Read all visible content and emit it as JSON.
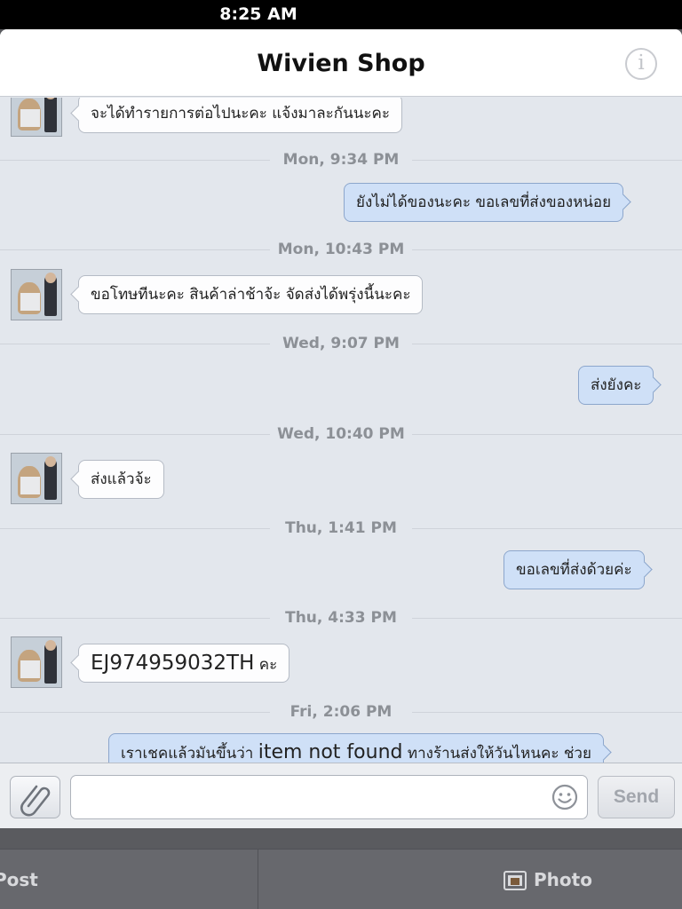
{
  "status_bar": {
    "time": "8:25 AM"
  },
  "header": {
    "title": "Wivien Shop",
    "info_icon": "info-icon"
  },
  "messages": [
    {
      "type": "in",
      "text": "จะได้ทำรายการต่อไปนะคะ แจ้งมาละกันนะคะ"
    },
    {
      "type": "time",
      "text": "Mon, 9:34 PM"
    },
    {
      "type": "out",
      "text": "ยังไม่ได้ของนะคะ ขอเลขที่ส่งของหน่อย"
    },
    {
      "type": "time",
      "text": "Mon, 10:43 PM"
    },
    {
      "type": "in",
      "text": "ขอโทษทีนะคะ สินค้าล่าช้าจ้ะ จัดส่งได้พรุ่งนี้นะคะ"
    },
    {
      "type": "time",
      "text": "Wed, 9:07 PM"
    },
    {
      "type": "out",
      "text": "ส่งยังคะ"
    },
    {
      "type": "time",
      "text": "Wed, 10:40 PM"
    },
    {
      "type": "in",
      "text": "ส่งแล้วจ้ะ"
    },
    {
      "type": "time",
      "text": "Thu, 1:41 PM"
    },
    {
      "type": "out",
      "text": "ขอเลขที่ส่งด้วยค่ะ"
    },
    {
      "type": "time",
      "text": "Thu, 4:33 PM"
    },
    {
      "type": "in",
      "text_main": "EJ974959032TH",
      "text_suffix": " คะ"
    },
    {
      "type": "time",
      "text": "Fri, 2:06 PM"
    },
    {
      "type": "out",
      "text_pre": "เราเชคแล้วมันขึ้นว่า ",
      "text_mid": "item not found",
      "text_post": " ทางร้านส่งให้วันไหนคะ ช่วย"
    }
  ],
  "composer": {
    "attach_icon": "paperclip-icon",
    "input_value": "",
    "input_placeholder": "",
    "emoji_icon": "smiley-icon",
    "send_label": "Send"
  },
  "bottom_bar": {
    "post_label": "Post",
    "photo_label": "Photo",
    "photo_icon": "photo-icon"
  },
  "colors": {
    "outgoing_bubble": "#cfe0f7",
    "incoming_bubble": "#fdfdfe",
    "chat_background": "#e3e7ed"
  }
}
